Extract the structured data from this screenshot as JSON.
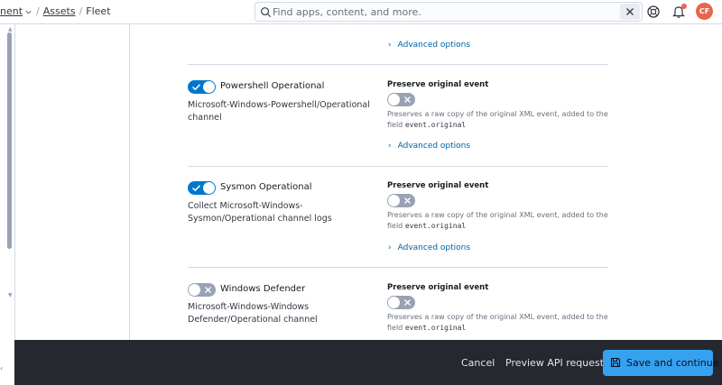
{
  "header": {
    "breadcrumbs": [
      "nent",
      "Assets",
      "Fleet"
    ],
    "search_placeholder": "Find apps, content, and more.",
    "avatar_initials": "CF"
  },
  "content": {
    "advanced_options_label": "Advanced options",
    "streams": [
      {
        "title": "Powershell Operational",
        "enabled": true,
        "description": "Microsoft-Windows-Powershell/Operational channel",
        "preserve_label": "Preserve original event",
        "preserve_enabled": false,
        "preserve_help_prefix": "Preserves a raw copy of the original XML event, added to the field",
        "preserve_help_code": "event.original"
      },
      {
        "title": "Sysmon Operational",
        "enabled": true,
        "description": "Collect Microsoft-Windows-Sysmon/Operational channel logs",
        "preserve_label": "Preserve original event",
        "preserve_enabled": false,
        "preserve_help_prefix": "Preserves a raw copy of the original XML event, added to the field",
        "preserve_help_code": "event.original"
      },
      {
        "title": "Windows Defender",
        "enabled": false,
        "description": "Microsoft-Windows-Windows Defender/Operational channel",
        "preserve_label": "Preserve original event",
        "preserve_enabled": false,
        "preserve_help_prefix": "Preserves a raw copy of the original XML event, added to the field",
        "preserve_help_code": "event.original"
      }
    ]
  },
  "footer": {
    "cancel_label": "Cancel",
    "preview_label": "Preview API request",
    "save_label": "Save and continue"
  },
  "colors": {
    "accent": "#0077cc",
    "save_button": "#36a2ef",
    "bottom_bar": "#25282f",
    "avatar": "#e7664c"
  }
}
